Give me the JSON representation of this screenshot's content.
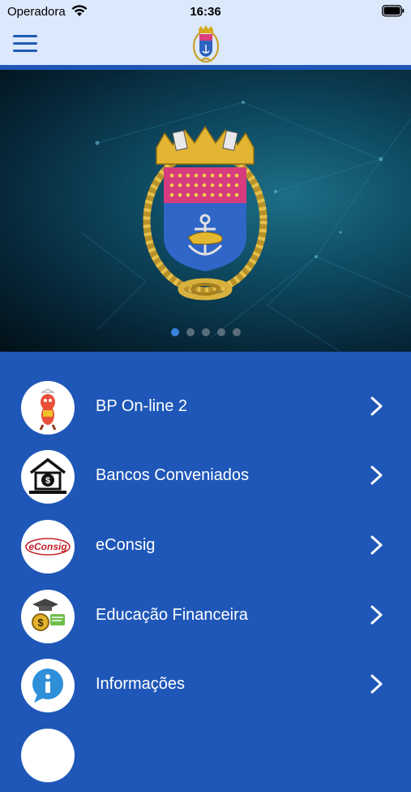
{
  "status_bar": {
    "carrier": "Operadora",
    "time": "16:36",
    "wifi_icon": "wifi-icon",
    "battery_icon": "battery-icon"
  },
  "header": {
    "menu_icon": "hamburger-menu-icon",
    "logo_icon": "naval-crest-logo"
  },
  "carousel": {
    "image": "naval-crest-emblem",
    "slide_count": 5,
    "active_slide": 1,
    "active_dot_color": "#3b82e0",
    "inactive_dot_color": "#5a6d7a"
  },
  "menu": {
    "items": [
      {
        "label": "BP On-line 2",
        "icon": "mascot-icon"
      },
      {
        "label": "Bancos Conveniados",
        "icon": "bank-icon"
      },
      {
        "label": "eConsig",
        "icon": "econsig-logo-icon",
        "icon_text": "eConsig"
      },
      {
        "label": "Educação Financeira",
        "icon": "financial-education-icon"
      },
      {
        "label": "Informações",
        "icon": "info-icon"
      }
    ]
  },
  "colors": {
    "header_bg": "#dce8fb",
    "accent": "#1f57b8",
    "text_on_accent": "#ffffff"
  }
}
